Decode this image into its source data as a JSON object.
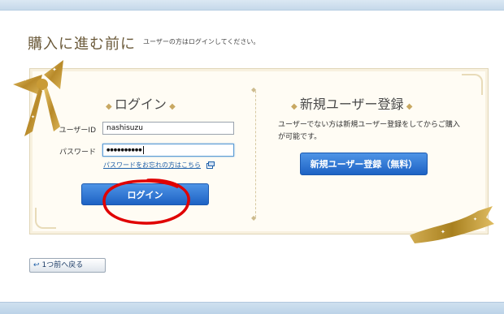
{
  "page": {
    "title": "購入に進む前に",
    "title_note": "ユーザーの方はログインしてください。"
  },
  "login": {
    "heading": "ログイン",
    "user_label": "ユーザーID",
    "user_value": "nashisuzu",
    "password_label": "パスワード",
    "password_value": "●●●●●●●●●●",
    "forgot_link": "パスワードをお忘れの方はこちら",
    "submit_label": "ログイン"
  },
  "register": {
    "heading": "新規ユーザー登録",
    "description": "ユーザーでない方は新規ユーザー登録をしてからご購入が可能です。",
    "button_label": "新規ユーザー登録（無料）"
  },
  "nav": {
    "back_label": "1つ前へ戻る"
  },
  "annotation": {
    "highlight_color": "#e00000",
    "highlight_target": "login-submit-button"
  },
  "theme": {
    "accent_blue": "#1d62c4",
    "gold": "#c8a862"
  },
  "icons": {
    "back": "back-arrow-icon",
    "external": "new-window-icon",
    "title_deco": "diamond-ornament-icon"
  }
}
